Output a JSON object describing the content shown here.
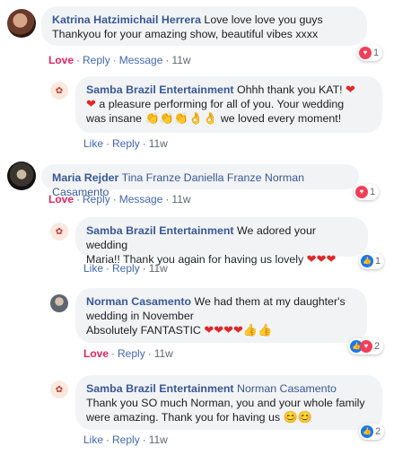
{
  "comments": [
    {
      "author": "Katrina Hatzimichail Herrera",
      "text_line1": "Love love love you guys",
      "text_line2": "Thankyou for your amazing show, beautiful vibes xxxx",
      "action_love": "Love",
      "action_reply": "Reply",
      "action_message": "Message",
      "time": "11w",
      "reaction_count": "1"
    },
    {
      "author": "Samba Brazil Entertainment",
      "text_line1": "Ohhh thank you KAT!",
      "text_line2": "a pleasure performing for all of you. Your wedding",
      "text_line3a": "was insane",
      "text_line3b": "we loved every moment!",
      "action_like": "Like",
      "action_reply": "Reply",
      "time": "11w"
    },
    {
      "author": "Maria Rejder",
      "tags": "Tina Franze Daniella Franze Norman Casamento",
      "action_love": "Love",
      "action_reply": "Reply",
      "action_message": "Message",
      "time": "11w",
      "reaction_count": "1"
    },
    {
      "author": "Samba Brazil Entertainment",
      "text_line1": "We adored your wedding",
      "text_line2": "Maria!! Thank you again for having us lovely",
      "action_like": "Like",
      "action_reply": "Reply",
      "time": "11w",
      "reaction_count": "1"
    },
    {
      "author": "Norman Casamento",
      "text_line1": "We had them at my daughter's",
      "text_line2": "wedding in November",
      "text_line3": "Absolutely FANTASTIC",
      "action_love": "Love",
      "action_reply": "Reply",
      "time": "11w",
      "reaction_count": "2"
    },
    {
      "author": "Samba Brazil Entertainment",
      "tag": "Norman Casamento",
      "text_line1": "Thank you SO much Norman, you and your whole family",
      "text_line2": "were amazing. Thank you for having us",
      "action_like": "Like",
      "action_reply": "Reply",
      "time": "11w",
      "reaction_count": "2"
    }
  ],
  "separator": "·",
  "colors": {
    "link": "#385898",
    "love": "#e0245e",
    "bubble": "#f2f3f5",
    "like_blue": "#1877f2",
    "love_red": "#f33e58"
  },
  "icons": [
    "love-reaction-icon",
    "like-reaction-icon",
    "heart-emoji",
    "clap-emoji",
    "ok-hand-emoji",
    "thumbs-up-emoji",
    "smile-emoji"
  ]
}
